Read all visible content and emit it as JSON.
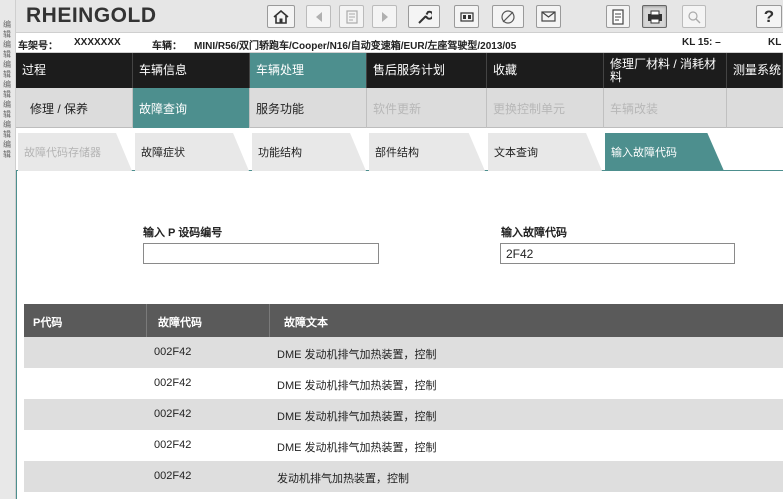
{
  "left_strip": {
    "text": "编辑 编辑 编辑 编辑 编辑 编辑 编辑"
  },
  "app": {
    "brand": "RHEINGOLD"
  },
  "toolbar": {
    "buttons": [
      {
        "name": "home-icon"
      },
      {
        "name": "back-icon"
      },
      {
        "name": "vehicle-identify-icon"
      },
      {
        "name": "forward-icon"
      },
      {
        "name": "wrench-icon"
      },
      {
        "name": "obd-connect-icon"
      },
      {
        "name": "measure-icon"
      },
      {
        "name": "mail-icon"
      },
      {
        "name": "document-icon"
      },
      {
        "name": "print-icon"
      },
      {
        "name": "zoom-icon"
      },
      {
        "name": "help-icon",
        "label": "?"
      }
    ]
  },
  "vehicle": {
    "vin_label": "车架号：",
    "vin_value": "XXXXXXX",
    "vehicle_label": "车辆：",
    "vehicle_value": "MINI/R56/双门轿跑车/Cooper/N16/自动变速箱/EUR/左座驾驶型/2013/05",
    "kl15": "KL 15:  –",
    "kl30": "KL"
  },
  "main_nav": {
    "tabs": [
      {
        "label": "过程"
      },
      {
        "label": "车辆信息"
      },
      {
        "label": "车辆处理",
        "active": true
      },
      {
        "label": "售后服务计划"
      },
      {
        "label": "收藏"
      },
      {
        "label": "修理厂材料 / 消耗材料"
      },
      {
        "label": "测量系统"
      }
    ]
  },
  "sub_nav": {
    "tabs": [
      {
        "label": "修理 / 保养"
      },
      {
        "label": "故障查询",
        "active": true
      },
      {
        "label": "服务功能"
      },
      {
        "label": "软件更新",
        "disabled": true
      },
      {
        "label": "更换控制单元",
        "disabled": true
      },
      {
        "label": "车辆改装",
        "disabled": true
      }
    ]
  },
  "third_nav": {
    "tabs": [
      {
        "label": "故障代码存储器",
        "disabled": true
      },
      {
        "label": "故障症状"
      },
      {
        "label": "功能结构"
      },
      {
        "label": "部件结构"
      },
      {
        "label": "文本查询"
      },
      {
        "label": "输入故障代码",
        "active": true
      }
    ]
  },
  "form": {
    "p_code_label": "输入 P 设码编号",
    "p_code_value": "",
    "fault_code_label": "输入故障代码",
    "fault_code_value": "2F42"
  },
  "results": {
    "headers": {
      "p_code": "P代码",
      "fault_code": "故障代码",
      "fault_text": "故障文本"
    },
    "rows": [
      {
        "p_code": "",
        "fault_code": "002F42",
        "fault_text": "DME 发动机排气加热装置，控制"
      },
      {
        "p_code": "",
        "fault_code": "002F42",
        "fault_text": "DME 发动机排气加热装置，控制"
      },
      {
        "p_code": "",
        "fault_code": "002F42",
        "fault_text": "DME 发动机排气加热装置，控制"
      },
      {
        "p_code": "",
        "fault_code": "002F42",
        "fault_text": "DME 发动机排气加热装置，控制"
      },
      {
        "p_code": "",
        "fault_code": "002F42",
        "fault_text": "发动机排气加热装置，控制"
      }
    ]
  },
  "colors": {
    "accent": "#4d8f8e",
    "nav_dark": "#1c1c1c",
    "table_header": "#5a5a5a",
    "row_alt": "#dedede"
  }
}
